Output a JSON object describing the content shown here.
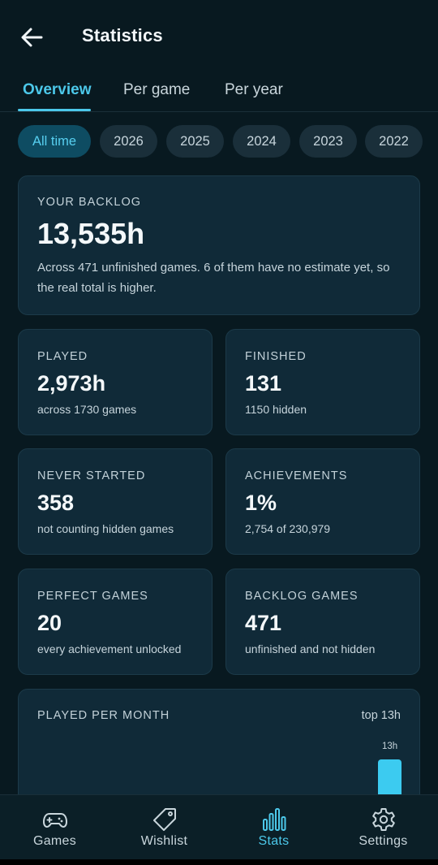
{
  "header": {
    "title": "Statistics"
  },
  "tabs": [
    {
      "label": "Overview",
      "active": true
    },
    {
      "label": "Per game",
      "active": false
    },
    {
      "label": "Per year",
      "active": false
    }
  ],
  "chips": [
    {
      "label": "All time",
      "active": true
    },
    {
      "label": "2026"
    },
    {
      "label": "2025"
    },
    {
      "label": "2024"
    },
    {
      "label": "2023"
    },
    {
      "label": "2022"
    }
  ],
  "backlog": {
    "label": "YOUR BACKLOG",
    "value": "13,535h",
    "description": "Across 471 unfinished games. 6 of them have no estimate yet, so the real total is higher."
  },
  "stats": {
    "played": {
      "label": "PLAYED",
      "value": "2,973h",
      "sub": "across 1730 games"
    },
    "finished": {
      "label": "FINISHED",
      "value": "131",
      "sub": "1150 hidden"
    },
    "never_started": {
      "label": "NEVER STARTED",
      "value": "358",
      "sub": "not counting hidden games"
    },
    "achievements": {
      "label": "ACHIEVEMENTS",
      "value": "1%",
      "sub": "2,754 of 230,979"
    },
    "perfect_games": {
      "label": "PERFECT GAMES",
      "value": "20",
      "sub": "every achievement unlocked"
    },
    "backlog_games": {
      "label": "BACKLOG GAMES",
      "value": "471",
      "sub": "unfinished and not hidden"
    }
  },
  "chart": {
    "label": "PLAYED PER MONTH",
    "top_label": "top 13h",
    "bar_value_label": "13h"
  },
  "chart_data": {
    "type": "bar",
    "title": "PLAYED PER MONTH",
    "values": [
      13
    ],
    "max": 13
  },
  "nav": [
    {
      "label": "Games",
      "icon": "gamepad-icon",
      "active": false
    },
    {
      "label": "Wishlist",
      "icon": "tag-icon",
      "active": false
    },
    {
      "label": "Stats",
      "icon": "bar-chart-icon",
      "active": true
    },
    {
      "label": "Settings",
      "icon": "gear-icon",
      "active": false
    }
  ],
  "colors": {
    "background": "#081920",
    "card": "#102a38",
    "accent": "#4cc8ea",
    "chip_active": "#0e4c62"
  }
}
